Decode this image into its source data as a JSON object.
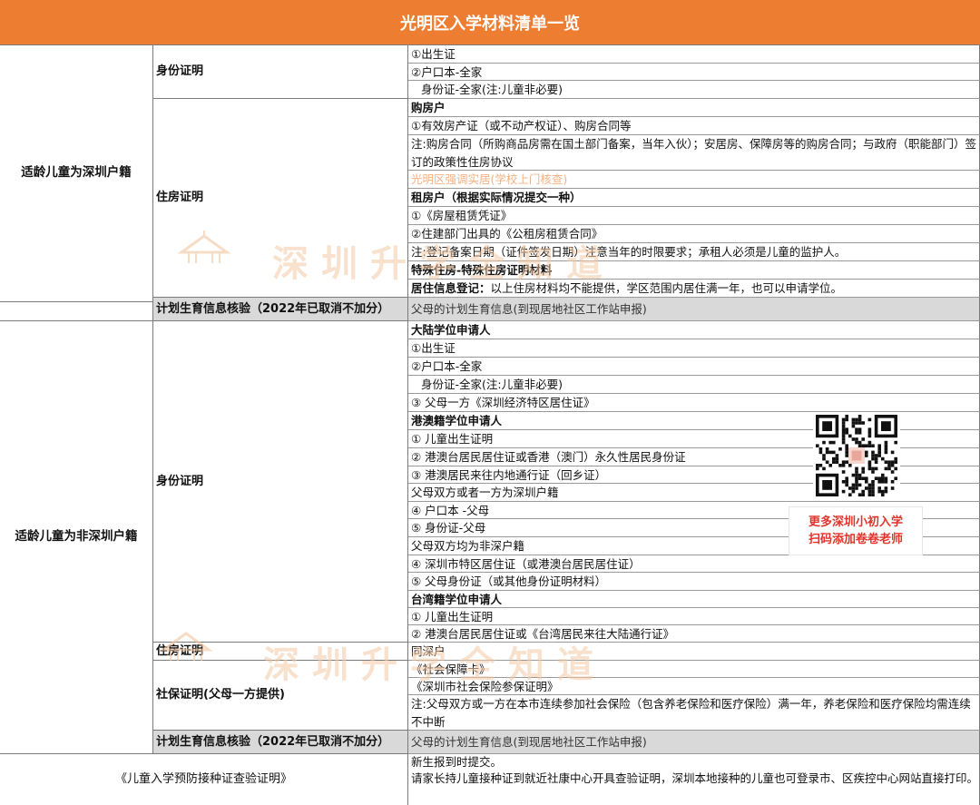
{
  "title": "光明区入学材料清单一览",
  "section_local": {
    "label": "适龄儿童为深圳户籍",
    "identity": {
      "label": "身份证明",
      "items": [
        "①出生证",
        "②户口本-全家",
        "身份证-全家(注:儿童非必要)"
      ]
    },
    "housing": {
      "label": "住房证明",
      "buyer_heading": "购房户",
      "buyer_item": "①有效房产证（或不动产权证）、购房合同等",
      "buyer_note": "注:购房合同（所购商品房需在国土部门备案，当年入伙）；安居房、保障房等的购房合同；与政府（职能部门）签订的政策性住房协议",
      "notice": "光明区强调实居(学校上门核查)",
      "renter_heading": "租房户（根据实际情况提交一种）",
      "renter_items": [
        "①《房屋租赁凭证》",
        "②住建部门出具的《公租房租赁合同》"
      ],
      "renter_note": "注:登记备案日期（证件签发日期）注意当年的时限要求；承租人必须是儿童的监护人。",
      "special_heading": "特殊住房-特殊住房证明材料",
      "residence_label": "居住信息登记：",
      "residence_text": "以上住房材料均不能提供，学区范围内居住满一年，也可以申请学位。"
    },
    "family_planning": {
      "label": "计划生育信息核验（2022年已取消不加分）",
      "value": "父母的计划生育信息(到现居地社区工作站申报)"
    }
  },
  "section_nonlocal": {
    "label": "适龄儿童为非深圳户籍",
    "identity": {
      "label": "身份证明",
      "mainland_heading": "大陆学位申请人",
      "mainland_items": [
        "①出生证",
        "②户口本-全家",
        "身份证-全家(注:儿童非必要)",
        "③ 父母一方《深圳经济特区居住证》"
      ],
      "hkmacao_heading": "港澳籍学位申请人",
      "hkmacao_items": [
        "① 儿童出生证明",
        "② 港澳台居民居住证或香港（澳门）永久性居民身份证",
        "③ 港澳居民来往内地通行证（回乡证）"
      ],
      "case_a": "父母双方或者一方为深圳户籍",
      "case_a_items": [
        "④ 户口本 -父母",
        "⑤ 身份证-父母"
      ],
      "case_b": "父母双方均为非深户籍",
      "case_b_items": [
        "④ 深圳市特区居住证（或港澳台居民居住证）",
        "⑤ 父母身份证（或其他身份证明材料）"
      ],
      "taiwan_heading": "台湾籍学位申请人",
      "taiwan_items": [
        "① 儿童出生证明",
        "② 港澳台居民居住证或《台湾居民来往大陆通行证》"
      ]
    },
    "housing": {
      "label": "住房证明",
      "value": "同深户"
    },
    "social": {
      "label": "社保证明(父母一方提供)",
      "items": [
        "《社会保障卡》",
        "《深圳市社会保险参保证明》"
      ],
      "note": "注:父母双方或一方在本市连续参加社会保险（包含养老保险和医疗保险）满一年，养老保险和医疗保险均需连续不中断"
    },
    "family_planning": {
      "label": "计划生育信息核验（2022年已取消不加分）",
      "value": "父母的计划生育信息(到现居地社区工作站申报)"
    }
  },
  "vaccination": {
    "label": "《儿童入学预防接种证查验证明》",
    "line1": "新生报到时提交。",
    "line2": "请家长持儿童接种证到就近社康中心开具查验证明，深圳本地接种的儿童也可登录市、区疾控中心网站直接打印。"
  },
  "promo": {
    "line1": "更多深圳小初入学",
    "line2": "扫码添加卷卷老师"
  },
  "watermark": {
    "brand": "深圳升学",
    "slogan": "深圳升学全知道"
  },
  "colors": {
    "header": "#ED7D31",
    "notice": "#F4B183",
    "promo": "#E0342B",
    "gray_row": "#D9D9D9"
  }
}
